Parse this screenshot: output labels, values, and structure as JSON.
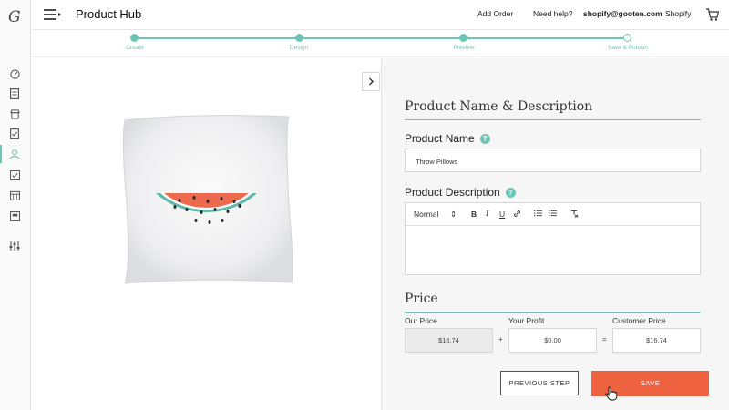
{
  "header": {
    "logo": "G",
    "title": "Product Hub",
    "nav": [
      "Add Order",
      "Need help?",
      "shopify@gooten.com",
      "Shopify"
    ]
  },
  "stepper": {
    "steps": [
      {
        "label": "Create",
        "state": "done"
      },
      {
        "label": "Design",
        "state": "done"
      },
      {
        "label": "Preview",
        "state": "done"
      },
      {
        "label": "Save & Publish",
        "state": "current"
      }
    ]
  },
  "sidebar": {
    "icons": [
      "dashboard-icon",
      "orders-icon",
      "store-icon",
      "checklist-icon",
      "product-hub-icon",
      "image-check-icon",
      "calendar-icon",
      "archive-icon",
      "settings-sliders-icon"
    ],
    "active": "product-hub-icon"
  },
  "preview": {
    "product": "throw-pillow-watermelon-image"
  },
  "form": {
    "section_name": "Product Name & Description",
    "product_name_label": "Product Name",
    "product_name_value": "Throw Pillows",
    "product_description_label": "Product Description",
    "editor_format": "Normal",
    "section_price": "Price",
    "price": {
      "our_price_label": "Our Price",
      "our_price": "$16.74",
      "profit_label": "Your Profit",
      "profit": "$0.00",
      "customer_price_label": "Customer Price",
      "customer_price": "$16.74",
      "plus": "+",
      "equals": "="
    },
    "previous_label": "PREVIOUS STEP",
    "save_label": "SAVE"
  },
  "colors": {
    "accent": "#6dc5b6",
    "save": "#ef6240",
    "watermelon_flesh": "#ee6a4f",
    "watermelon_rind": "#5fb8a8"
  }
}
